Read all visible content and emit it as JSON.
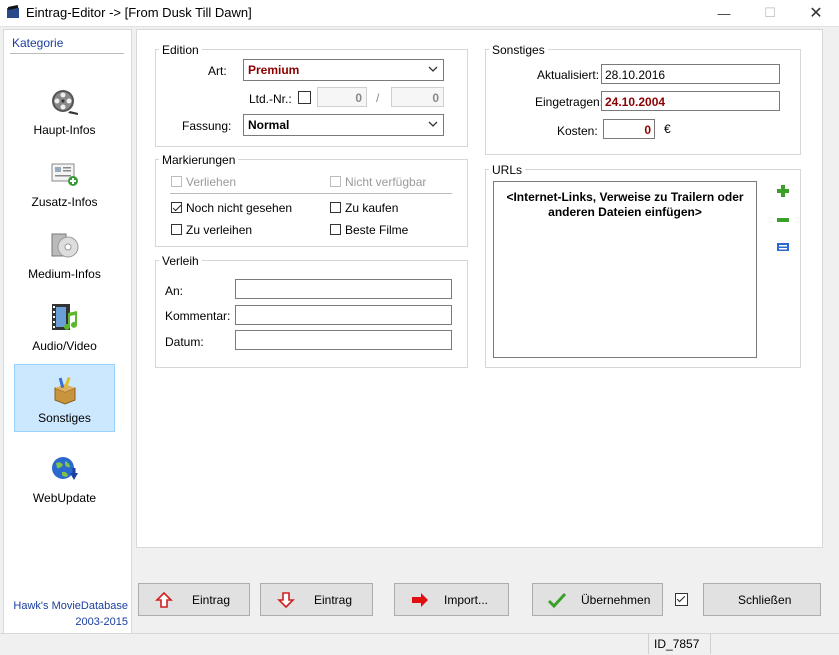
{
  "window": {
    "title": "Eintrag-Editor -> [From Dusk Till Dawn]"
  },
  "sidebar": {
    "heading": "Kategorie",
    "items": [
      {
        "label": "Haupt-Infos",
        "icon": "film-reel-icon"
      },
      {
        "label": "Zusatz-Infos",
        "icon": "info-card-icon"
      },
      {
        "label": "Medium-Infos",
        "icon": "disc-icon"
      },
      {
        "label": "Audio/Video",
        "icon": "filmstrip-music-icon"
      },
      {
        "label": "Sonstiges",
        "icon": "box-icon",
        "active": true
      },
      {
        "label": "WebUpdate",
        "icon": "globe-download-icon"
      }
    ],
    "brand": "Hawk's MovieDatabase",
    "years": "2003-2015"
  },
  "edition": {
    "title": "Edition",
    "art_label": "Art:",
    "art_value": "Premium",
    "ltd_label": "Ltd.-Nr.:",
    "ltd_checked": false,
    "ltd_num": "0",
    "ltd_sep": "/",
    "ltd_total": "0",
    "fassung_label": "Fassung:",
    "fassung_value": "Normal"
  },
  "markierungen": {
    "title": "Markierungen",
    "verliehen": "Verliehen",
    "nicht_verfuegbar": "Nicht verfügbar",
    "noch_nicht_gesehen": "Noch nicht gesehen",
    "zu_kaufen": "Zu kaufen",
    "zu_verleihen": "Zu verleihen",
    "beste_filme": "Beste Filme"
  },
  "verleih": {
    "title": "Verleih",
    "an_label": "An:",
    "kommentar_label": "Kommentar:",
    "datum_label": "Datum:"
  },
  "sonstiges": {
    "title": "Sonstiges",
    "aktualisiert_label": "Aktualisiert:",
    "aktualisiert_value": "28.10.2016",
    "eingetragen_label": "Eingetragen:",
    "eingetragen_value": "24.10.2004",
    "kosten_label": "Kosten:",
    "kosten_value": "0",
    "currency": "€"
  },
  "urls": {
    "title": "URLs",
    "placeholder": "<Internet-Links, Verweise zu Trailern oder anderen Dateien einfügen>"
  },
  "buttons": {
    "eintrag_up": "Eintrag",
    "eintrag_down": "Eintrag",
    "import": "Import...",
    "uebernehmen": "Übernehmen",
    "schliessen": "Schließen"
  },
  "status": {
    "id": "ID_7857"
  },
  "colors": {
    "accent_red": "#8b0000",
    "link_blue": "#1b3fa0",
    "active_bg": "#cce8ff"
  }
}
